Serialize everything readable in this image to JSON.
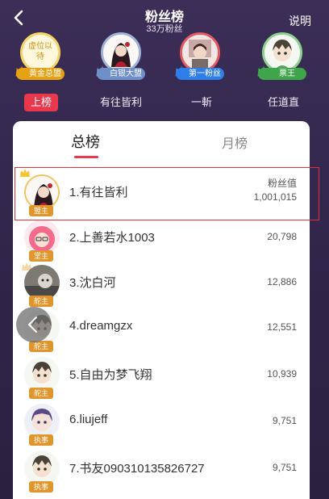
{
  "header": {
    "title": "粉丝榜",
    "subtitle": "33万粉丝",
    "explain_label": "说明"
  },
  "badges": [
    {
      "name": "黄金总盟",
      "caption": "虚位以待",
      "color": "#e6a115"
    },
    {
      "name": "白银大盟",
      "caption": "",
      "color": "#6f8fc7"
    },
    {
      "name": "第一粉丝",
      "caption": "",
      "color": "#2f7ee8"
    },
    {
      "name": "票王",
      "caption": "",
      "color": "#3fa54a"
    }
  ],
  "top_tabs": [
    "上榜",
    "有往皆利",
    "一斬",
    "任道直"
  ],
  "panel": {
    "tab_total": "总榜",
    "tab_month": "月榜"
  },
  "rows": [
    {
      "name": "1.有往皆利",
      "role": "盟主",
      "value_label": "粉丝值",
      "value": "1,001,015",
      "role_color": "#e0962c"
    },
    {
      "name": "2.上善若水1003",
      "role": "堂主",
      "value": "20,798",
      "role_color": "#e0962c"
    },
    {
      "name": "3.沈白河",
      "role": "舵主",
      "value": "12,886",
      "role_color": "#e0962c"
    },
    {
      "name": "4.dreamgzx",
      "role": "舵主",
      "value": "12,551",
      "role_color": "#e0962c"
    },
    {
      "name": "5.自由为梦飞翔",
      "role": "舵主",
      "value": "10,939",
      "role_color": "#e0962c"
    },
    {
      "name": "6.liujeff",
      "role": "执事",
      "value": "9,751",
      "role_color": "#e0962c"
    },
    {
      "name": "7.书友090310135826727",
      "role": "执事",
      "value": "9,751",
      "role_color": "#e0962c"
    }
  ],
  "colors": {
    "accent": "#e8384d",
    "background": "#332850"
  }
}
